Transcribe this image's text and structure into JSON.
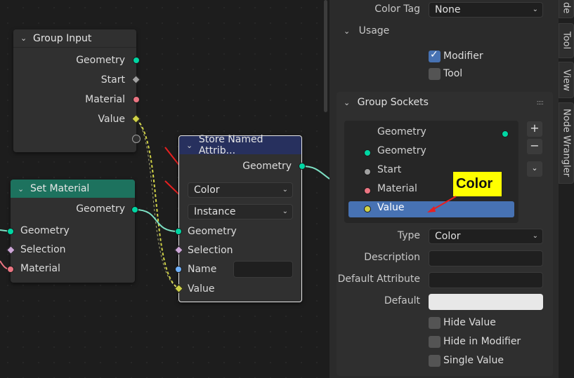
{
  "colors": {
    "geometry_socket": "#00d6a3",
    "float_socket": "#a1a1a1",
    "material_socket": "#eb7582",
    "value_socket": "#cfd146",
    "selection_socket": "#cca6d6",
    "name_socket": "#70b2ff",
    "set_material_header": "#1d725e",
    "store_named_header": "#27305e",
    "selected_item": "#4772b3",
    "annotation_arrow": "#e82020",
    "callout_bg": "#ffff00"
  },
  "group_input": {
    "title": "Group Input",
    "sockets": [
      "Geometry",
      "Start",
      "Material",
      "Value"
    ]
  },
  "set_material": {
    "title": "Set Material",
    "output": "Geometry",
    "inputs": [
      "Geometry",
      "Selection",
      "Material"
    ]
  },
  "store_named": {
    "title": "Store Named Attrib...",
    "output": "Geometry",
    "data_type": "Color",
    "domain": "Instance",
    "inputs": [
      "Geometry",
      "Selection",
      "Name",
      "Value"
    ]
  },
  "props": {
    "color_tag_label": "Color Tag",
    "color_tag_value": "None",
    "usage_label": "Usage",
    "modifier_label": "Modifier",
    "tool_label": "Tool",
    "group_sockets_label": "Group Sockets",
    "socket_list": [
      {
        "label": "Geometry",
        "type": "output"
      },
      {
        "label": "Geometry",
        "type": "input"
      },
      {
        "label": "Start",
        "type": "input"
      },
      {
        "label": "Material",
        "type": "input"
      },
      {
        "label": "Value",
        "type": "input"
      }
    ],
    "type_label": "Type",
    "type_value": "Color",
    "description_label": "Description",
    "default_attribute_label": "Default Attribute",
    "default_label": "Default",
    "hide_value_label": "Hide Value",
    "hide_in_modifier_label": "Hide in Modifier",
    "single_value_label": "Single Value"
  },
  "side_tabs": [
    "de",
    "Tool",
    "View",
    "Node Wrangler"
  ],
  "callout": {
    "text": "Color"
  }
}
